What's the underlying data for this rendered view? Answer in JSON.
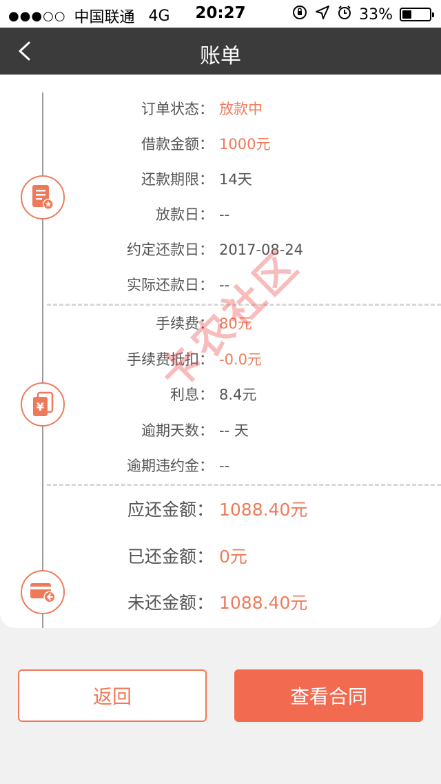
{
  "status_bar": {
    "signal": "●●●○○",
    "carrier": "中国联通",
    "network": "4G",
    "time": "20:27",
    "battery_text": "33%",
    "battery_level": 0.33
  },
  "nav": {
    "title": "账单"
  },
  "bill": {
    "section1": [
      {
        "label": "订单状态：",
        "value": "放款中",
        "accent": true
      },
      {
        "label": "借款金额：",
        "value": "1000元",
        "accent": true
      },
      {
        "label": "还款期限：",
        "value": "14天",
        "accent": false
      },
      {
        "label": "放款日：",
        "value": "--",
        "accent": false
      },
      {
        "label": "约定还款日：",
        "value": "2017-08-24",
        "accent": false
      },
      {
        "label": "实际还款日：",
        "value": "--",
        "accent": false
      }
    ],
    "section2": [
      {
        "label": "手续费：",
        "value": "80元",
        "accent": true
      },
      {
        "label": "手续费抵扣：",
        "value": "-0.0元",
        "accent": true
      },
      {
        "label": "利息：",
        "value": "8.4元",
        "accent": false
      },
      {
        "label": "逾期天数：",
        "value": "-- 天",
        "accent": false
      },
      {
        "label": "逾期违约金：",
        "value": "--",
        "accent": false
      }
    ],
    "section3": [
      {
        "label": "应还金额：",
        "value": "1088.40元"
      },
      {
        "label": "已还金额：",
        "value": "0元"
      },
      {
        "label": "未还金额：",
        "value": "1088.40元"
      }
    ]
  },
  "watermark": "卡农社区",
  "buttons": {
    "return_label": "返回",
    "contract_label": "查看合同"
  },
  "colors": {
    "accent": "#ef7a5a",
    "nav_bg": "#3b3b3b",
    "primary_button": "#f26a50"
  }
}
